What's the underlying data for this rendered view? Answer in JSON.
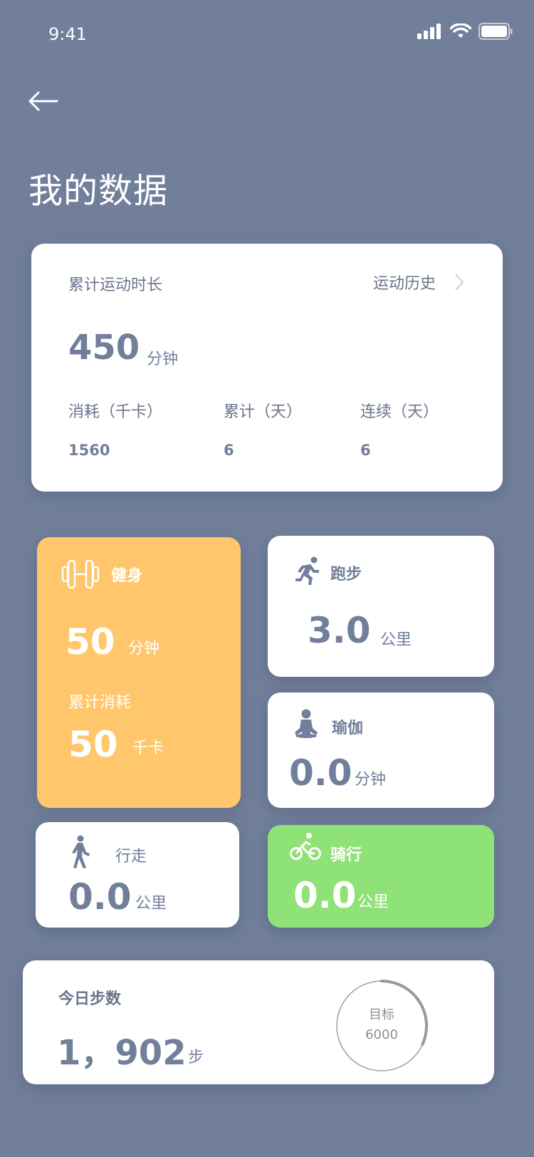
{
  "status_bar": {
    "time": "9:41"
  },
  "page": {
    "title": "我的数据"
  },
  "summary": {
    "label": "累计运动时长",
    "history_link": "运动历史",
    "total_value": "450",
    "total_unit": "分钟",
    "stats": [
      {
        "label": "消耗（千卡）",
        "value": "1560"
      },
      {
        "label": "累计（天）",
        "value": "6"
      },
      {
        "label": "连续（天）",
        "value": "6"
      }
    ]
  },
  "fitness": {
    "title": "健身",
    "duration_value": "50",
    "duration_unit": "分钟",
    "consumption_label": "累计消耗",
    "consumption_value": "50",
    "consumption_unit": "千卡",
    "color": "#ffc66c"
  },
  "running": {
    "title": "跑步",
    "value": "3.0",
    "unit": "公里"
  },
  "yoga": {
    "title": "瑜伽",
    "value": "0.0",
    "unit": "分钟"
  },
  "walking": {
    "title": "行走",
    "value": "0.0",
    "unit": "公里"
  },
  "cycling": {
    "title": "骑行",
    "value": "0.0",
    "unit": "公里",
    "color": "#8fe276"
  },
  "steps": {
    "label": "今日步数",
    "value": "1，902",
    "unit": "步",
    "goal_label": "目标",
    "goal_value": "6000",
    "progress": 0.317
  },
  "colors": {
    "background": "#717f9b",
    "text": "#717f9b"
  },
  "icons": [
    "back-arrow-icon",
    "chevron-right-icon",
    "dumbbell-icon",
    "runner-icon",
    "yoga-icon",
    "walker-icon",
    "bicycle-icon",
    "signal-icon",
    "wifi-icon",
    "battery-icon"
  ]
}
